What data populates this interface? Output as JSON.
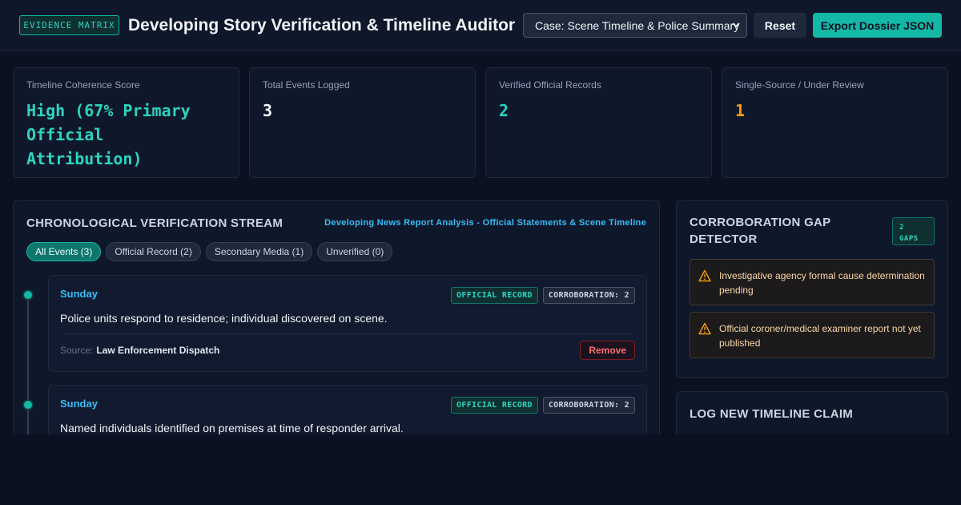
{
  "header": {
    "brand": "EVIDENCE MATRIX",
    "title": "Developing Story Verification & Timeline Auditor",
    "case_select": "Case: Scene Timeline & Police Summary",
    "reset_label": "Reset",
    "export_label": "Export Dossier JSON"
  },
  "stats": [
    {
      "label": "Timeline Coherence Score",
      "value": "High (67% Primary Official Attribution)",
      "color": "#2dd4bf"
    },
    {
      "label": "Total Events Logged",
      "value": "3",
      "color": "#f1f5f9"
    },
    {
      "label": "Verified Official Records",
      "value": "2",
      "color": "#2dd4bf"
    },
    {
      "label": "Single-Source / Under Review",
      "value": "1",
      "color": "#f59e0b"
    }
  ],
  "stream": {
    "title": "CHRONOLOGICAL VERIFICATION STREAM",
    "subtitle": "Developing News Report Analysis - Official Statements & Scene Timeline",
    "filters": [
      "All Events (3)",
      "Official Record (2)",
      "Secondary Media (1)",
      "Unverified (0)"
    ],
    "events": [
      {
        "day": "Sunday",
        "tag_type": "OFFICIAL RECORD",
        "tag_corr": "CORROBORATION: 2",
        "text": "Police units respond to residence; individual discovered on scene.",
        "source_label": "Source:",
        "source": "Law Enforcement Dispatch",
        "remove_label": "Remove"
      },
      {
        "day": "Sunday",
        "tag_type": "OFFICIAL RECORD",
        "tag_corr": "CORROBORATION: 2",
        "text": "Named individuals identified on premises at time of responder arrival."
      }
    ]
  },
  "gap_detector": {
    "title": "CORROBORATION GAP DETECTOR",
    "badge": "2 GAPS",
    "items": [
      "Investigative agency formal cause determination pending",
      "Official coroner/medical examiner report not yet published"
    ]
  },
  "log_new": {
    "title": "LOG NEW TIMELINE CLAIM"
  },
  "colors": {
    "accent": "#14b8a6",
    "link": "#38bdf8",
    "warning": "#f59e0b",
    "danger": "#f87171"
  }
}
